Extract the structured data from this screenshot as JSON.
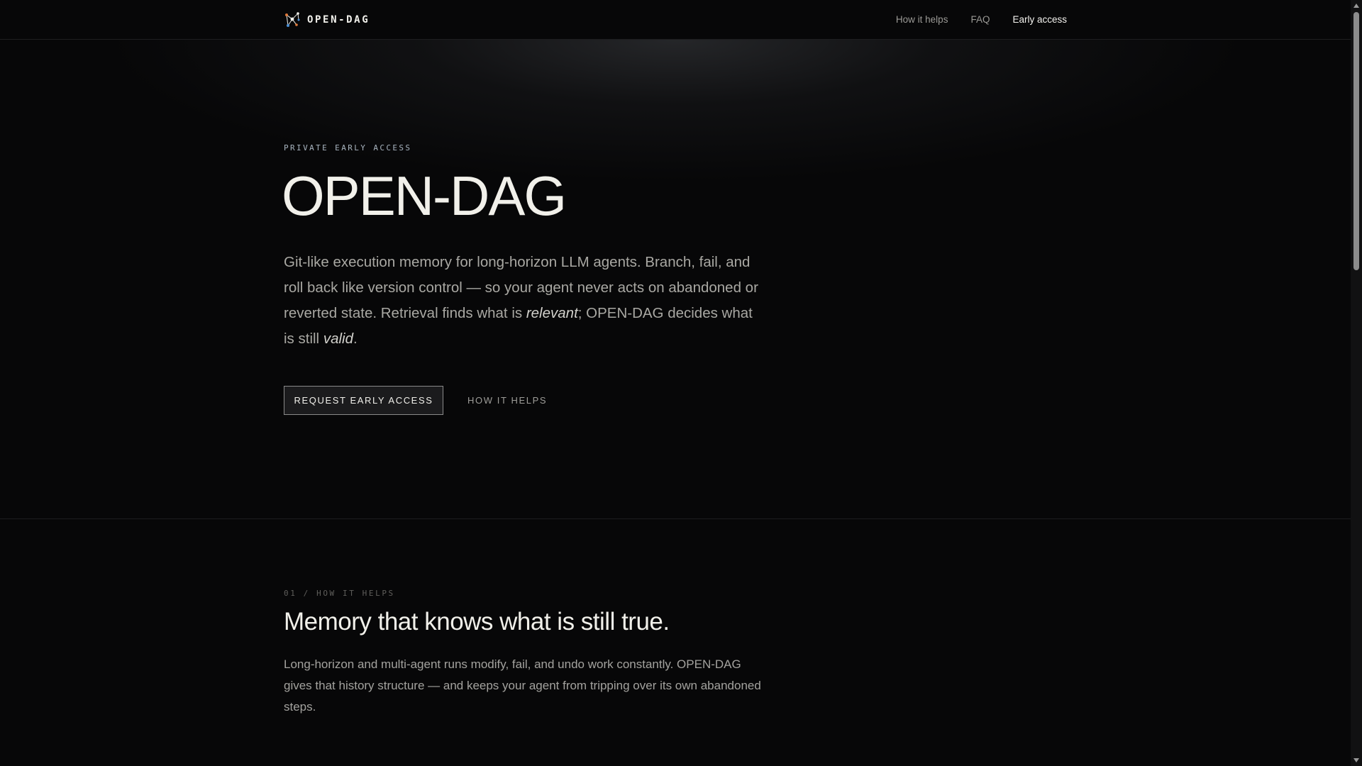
{
  "nav": {
    "brand": "OPEN-DAG",
    "logo_icon": "dag-graph-icon",
    "links": [
      "How it helps",
      "FAQ",
      "Early access"
    ],
    "active_link": "Early access"
  },
  "hero": {
    "eyebrow": "PRIVATE EARLY ACCESS",
    "title": "OPEN-DAG",
    "description": {
      "part1": "Git-like execution memory for long-horizon LLM agents. Branch, fail, and roll back like version control — so your agent never acts on abandoned or reverted state. Retrieval finds what is ",
      "emphasis1": "relevant",
      "part2": "; OPEN-DAG decides what is still ",
      "emphasis2": "valid",
      "part3": "."
    },
    "primary_button": "REQUEST EARLY ACCESS",
    "secondary_button": "HOW IT HELPS"
  },
  "section_how": {
    "kicker": "01 / HOW IT HELPS",
    "title": "Memory that knows what is still true.",
    "description": "Long-horizon and multi-agent runs modify, fail, and undo work constantly. OPEN-DAG gives that history structure — and keeps your agent from tripping over its own abandoned steps."
  },
  "colors": {
    "background": "#070708",
    "text_primary": "#f1f0ea",
    "text_muted": "#a9a8a3",
    "eyebrow": "#a8b4bf",
    "logo_accent_orange": "#e07a3c",
    "logo_accent_blue": "#4a8fd6"
  },
  "scrollbar": {
    "up_icon": "scroll-up-arrow-icon",
    "down_icon": "scroll-down-arrow-icon"
  }
}
